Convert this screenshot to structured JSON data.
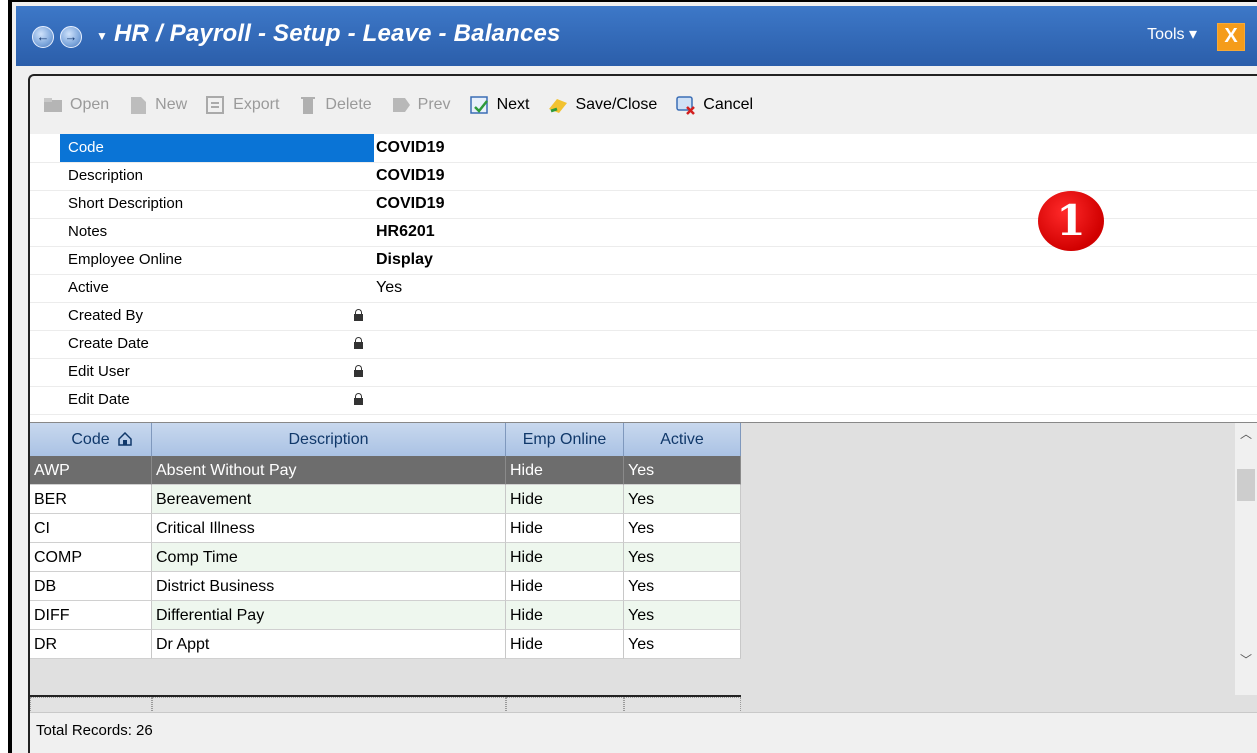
{
  "window": {
    "title": "HR / Payroll - Setup - Leave - Balances",
    "tools_label": "Tools ▾",
    "close_glyph": "X",
    "accent": "#2b5eaa"
  },
  "toolbar": {
    "open": "Open",
    "new": "New",
    "export": "Export",
    "delete": "Delete",
    "prev": "Prev",
    "next": "Next",
    "save_close": "Save/Close",
    "cancel": "Cancel"
  },
  "properties": [
    {
      "label": "Code",
      "value": "COVID19",
      "bold": true,
      "locked": false,
      "selected": true
    },
    {
      "label": "Description",
      "value": "COVID19",
      "bold": true,
      "locked": false
    },
    {
      "label": "Short Description",
      "value": "COVID19",
      "bold": true,
      "locked": false
    },
    {
      "label": "Notes",
      "value": "HR6201",
      "bold": true,
      "locked": false
    },
    {
      "label": "Employee Online",
      "value": "Display",
      "bold": true,
      "locked": false
    },
    {
      "label": "Active",
      "value": "Yes",
      "bold": false,
      "locked": false
    },
    {
      "label": "Created By",
      "value": "",
      "locked": true
    },
    {
      "label": "Create Date",
      "value": "",
      "locked": true
    },
    {
      "label": "Edit User",
      "value": "",
      "locked": true
    },
    {
      "label": "Edit Date",
      "value": "",
      "locked": true
    }
  ],
  "badge": "1",
  "grid": {
    "columns": [
      "Code",
      "Description",
      "Emp Online",
      "Active"
    ],
    "rows": [
      {
        "code": "AWP",
        "description": "Absent Without Pay",
        "emp_online": "Hide",
        "active": "Yes"
      },
      {
        "code": "BER",
        "description": "Bereavement",
        "emp_online": "Hide",
        "active": "Yes"
      },
      {
        "code": "CI",
        "description": "Critical Illness",
        "emp_online": "Hide",
        "active": "Yes"
      },
      {
        "code": "COMP",
        "description": "Comp Time",
        "emp_online": "Hide",
        "active": "Yes"
      },
      {
        "code": "DB",
        "description": "District Business",
        "emp_online": "Hide",
        "active": "Yes"
      },
      {
        "code": "DIFF",
        "description": "Differential Pay",
        "emp_online": "Hide",
        "active": "Yes"
      },
      {
        "code": "DR",
        "description": "Dr Appt",
        "emp_online": "Hide",
        "active": "Yes"
      }
    ]
  },
  "status": {
    "total_records": "Total Records: 26"
  }
}
